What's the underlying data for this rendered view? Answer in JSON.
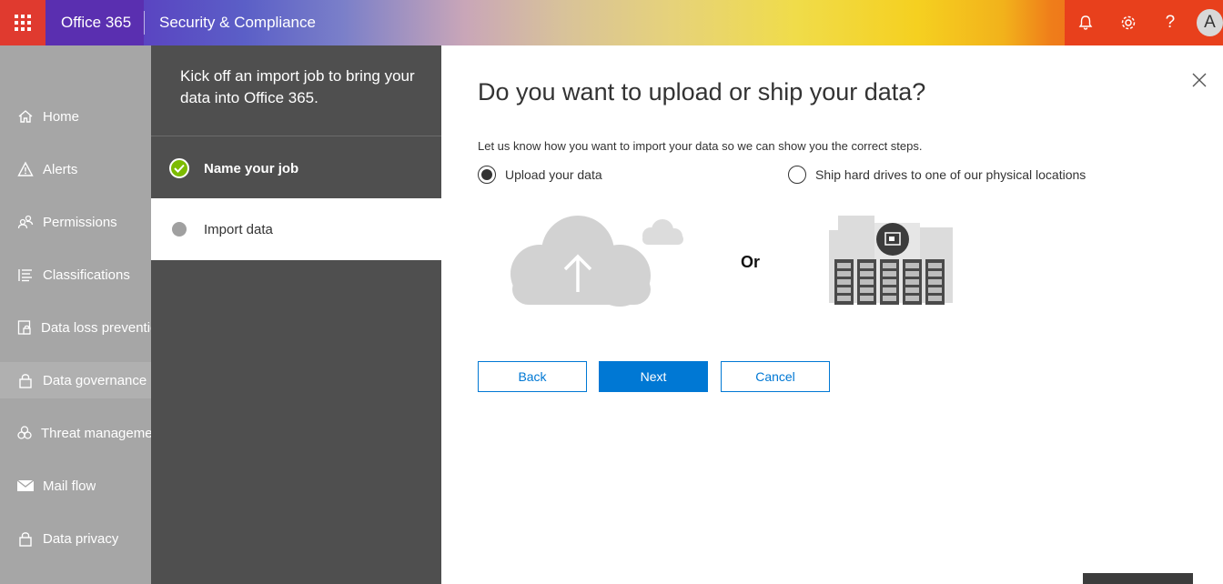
{
  "topbar": {
    "brand": "Office 365",
    "app_title": "Security & Compliance",
    "avatar_initial": "A",
    "icons": [
      "waffle-icon",
      "bell-icon",
      "gear-icon",
      "help-icon"
    ],
    "help_glyph": "?"
  },
  "nav": {
    "items": [
      {
        "label": "Home",
        "icon": "home-icon"
      },
      {
        "label": "Alerts",
        "icon": "warning-icon"
      },
      {
        "label": "Permissions",
        "icon": "people-icon"
      },
      {
        "label": "Classifications",
        "icon": "list-icon"
      },
      {
        "label": "Data loss prevention",
        "icon": "lock-doc-icon"
      },
      {
        "label": "Data governance",
        "icon": "lock-icon"
      },
      {
        "label": "Threat management",
        "icon": "biohazard-icon"
      },
      {
        "label": "Mail flow",
        "icon": "mail-icon"
      },
      {
        "label": "Data privacy",
        "icon": "lock-icon"
      }
    ],
    "active_index": 5
  },
  "wizard": {
    "intro": "Kick off an import job to bring your data into Office 365.",
    "steps": [
      {
        "label": "Name your job",
        "status": "done"
      },
      {
        "label": "Import data",
        "status": "current"
      }
    ]
  },
  "main": {
    "title": "Do you want to upload or ship your data?",
    "description": "Let us know how you want to import your data so we can show you the correct steps.",
    "options": [
      {
        "label": "Upload your data",
        "selected": true
      },
      {
        "label": "Ship hard drives to one of our physical locations",
        "selected": false
      }
    ],
    "or_label": "Or",
    "buttons": {
      "back": "Back",
      "next": "Next",
      "cancel": "Cancel"
    }
  },
  "colors": {
    "accent": "#0078d4",
    "wizard_panel": "#4f4f4f",
    "nav_bg": "#a6a6a6",
    "check_green": "#7cbb00",
    "waffle_red": "#e03a2f",
    "brand_purple": "#5a2fb0"
  }
}
